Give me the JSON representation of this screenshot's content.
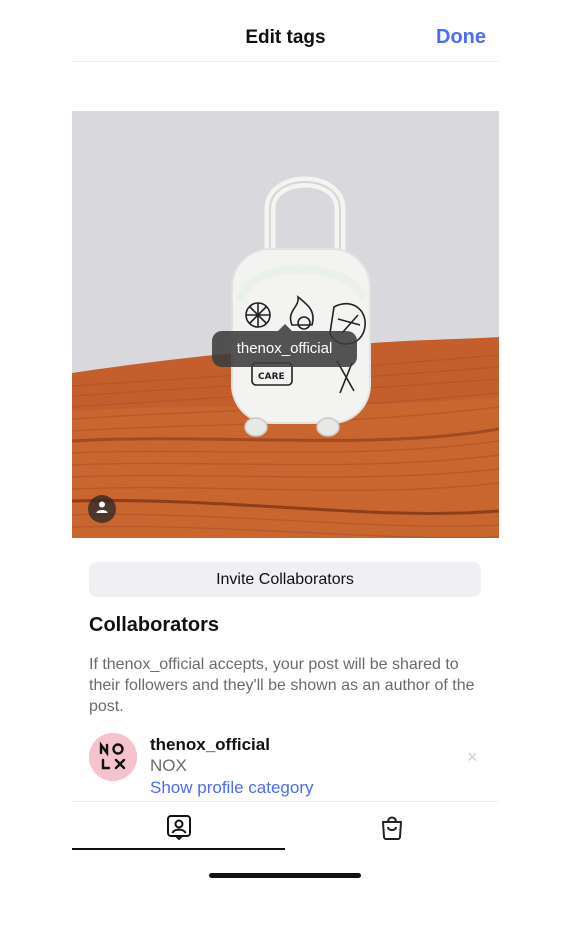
{
  "header": {
    "title": "Edit tags",
    "done_label": "Done"
  },
  "photo": {
    "tag_label": "thenox_official",
    "tag_user_icon": "person-icon"
  },
  "invite": {
    "label": "Invite Collaborators"
  },
  "collaborators": {
    "heading": "Collaborators",
    "description": "If thenox_official accepts, your post will be shared to their followers and they'll be shown as an author of the post.",
    "items": [
      {
        "username": "thenox_official",
        "name": "NOX",
        "link": "Show profile category",
        "remove_icon": "close-icon"
      }
    ]
  },
  "tabs": {
    "items": [
      {
        "name": "people",
        "icon": "person-tag-icon",
        "active": true
      },
      {
        "name": "products",
        "icon": "shopping-bag-icon",
        "active": false
      }
    ]
  },
  "colors": {
    "accent": "#4a6cf7",
    "couch": "#c9602e",
    "wall": "#d9d8dd",
    "avatar_bg": "#f6c3cc"
  }
}
